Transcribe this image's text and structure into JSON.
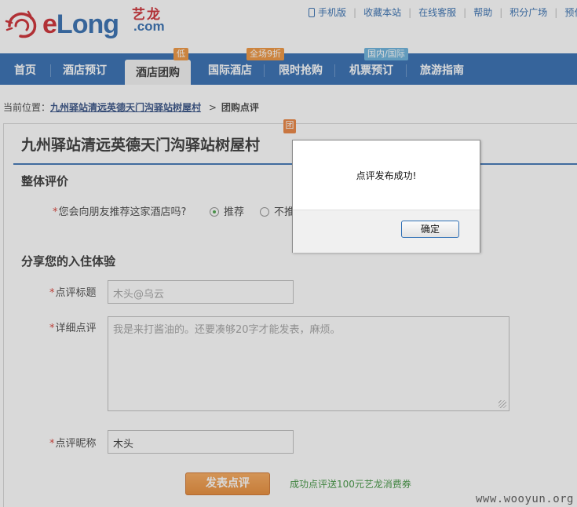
{
  "brand": {
    "logo_e": "e",
    "logo_long": "Long",
    "logo_cn": "艺龙",
    "logo_com": ".com"
  },
  "toplinks": [
    "手机版",
    "收藏本站",
    "在线客服",
    "帮助",
    "积分广场",
    "预付"
  ],
  "nav": {
    "items": [
      "首页",
      "酒店预订",
      "酒店团购",
      "国际酒店",
      "限时抢购",
      "机票预订",
      "旅游指南"
    ],
    "badges": {
      "tuangou": "低",
      "intl_hotel": "全场9折",
      "flight": "国内/国际"
    }
  },
  "breadcrumb": {
    "prefix": "当前位置：",
    "hotel_link": "九州驿站清远英德天门沟驿站树屋村",
    "arrow": ">",
    "current": "团购点评"
  },
  "hotel": {
    "title": "九州驿站清远英德天门沟驿站树屋村",
    "badge": "团"
  },
  "overall": {
    "heading": "整体评价",
    "question": "您会向朋友推荐这家酒店吗?",
    "required_mark": "*",
    "options": [
      "推荐",
      "不推"
    ],
    "selected_index": 0
  },
  "experience": {
    "heading": "分享您的入住体验",
    "title_label": "点评标题",
    "title_value": "木头@乌云",
    "detail_label": "详细点评",
    "detail_value": "我是来打酱油的。还要凑够20字才能发表，麻烦。",
    "nick_label": "点评昵称",
    "nick_value": "木头",
    "submit_label": "发表点评",
    "promo_text": "成功点评送100元艺龙消费券"
  },
  "dialog": {
    "message": "点评发布成功!",
    "ok_label": "确定"
  },
  "watermark": "www.wooyun.org",
  "colors": {
    "nav_blue": "#1e5ea9",
    "brand_red": "#c8161d",
    "accent_orange": "#e57f22",
    "promo_green": "#2e8b2e"
  }
}
